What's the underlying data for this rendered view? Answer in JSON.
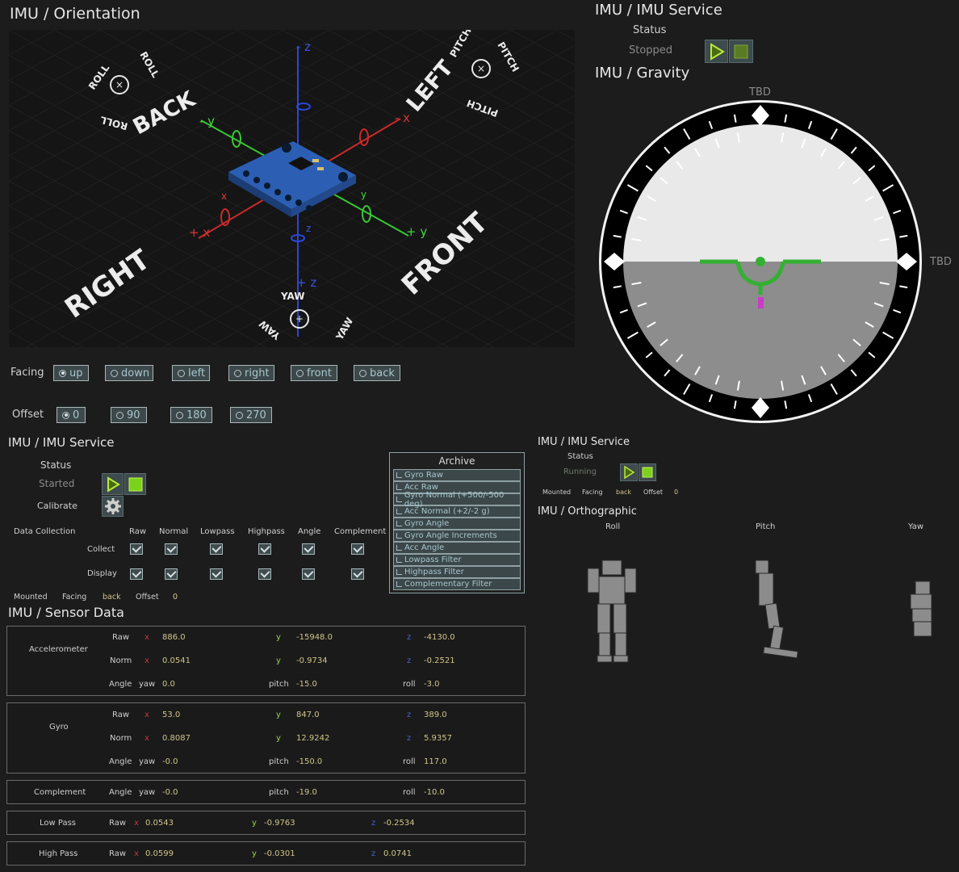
{
  "orientation": {
    "title": "IMU / Orientation",
    "labels": {
      "roll": "ROLL",
      "pitch": "PITCH",
      "yaw": "YAW",
      "back": "BACK",
      "left": "LEFT",
      "right": "RIGHT",
      "front": "FRONT"
    },
    "axes": {
      "neg_z": "- z",
      "pos_z": "+ z",
      "neg_y": "- y",
      "pos_y": "+ y",
      "neg_x": "- x",
      "pos_x": "+ x",
      "x": "x",
      "y": "y",
      "z": "z"
    }
  },
  "facing": {
    "label": "Facing",
    "options": [
      "up",
      "down",
      "left",
      "right",
      "front",
      "back"
    ],
    "selected": "up"
  },
  "offset": {
    "label": "Offset",
    "options": [
      "0",
      "90",
      "180",
      "270"
    ],
    "selected": "0"
  },
  "service_top": {
    "title": "IMU / IMU Service",
    "status_label": "Status",
    "status_value": "Stopped"
  },
  "gravity": {
    "title": "IMU / Gravity",
    "top_label": "TBD",
    "right_label": "TBD"
  },
  "service_main": {
    "title": "IMU / IMU Service",
    "status_label": "Status",
    "status_value": "Started",
    "calibrate_label": "Calibrate",
    "data_collection_label": "Data Collection",
    "columns": [
      "Raw",
      "Normal",
      "Lowpass",
      "Highpass",
      "Angle",
      "Complement"
    ],
    "row_collect": "Collect",
    "row_display": "Display",
    "mounted_label": "Mounted",
    "facing_label": "Facing",
    "facing_value": "back",
    "offset_label": "Offset",
    "offset_value": "0"
  },
  "archive": {
    "title": "Archive",
    "items": [
      "Gyro Raw",
      "Acc Raw",
      "Gyro Normal (+500/-500 deg)",
      "Acc Normal (+2/-2 g)",
      "Gyro Angle",
      "Gyro Angle Increments",
      "Acc Angle",
      "Lowpass Filter",
      "Highpass Filter",
      "Complementary Filter"
    ]
  },
  "service_right": {
    "title": "IMU / IMU Service",
    "status_label": "Status",
    "status_value": "Running",
    "mounted_label": "Mounted",
    "facing_label": "Facing",
    "facing_value": "back",
    "offset_label": "Offset",
    "offset_value": "0"
  },
  "ortho": {
    "title": "IMU / Orthographic",
    "roll": "Roll",
    "pitch": "Pitch",
    "yaw": "Yaw"
  },
  "sensor": {
    "title": "IMU / Sensor Data",
    "accelerometer": {
      "label": "Accelerometer",
      "raw": {
        "label": "Raw",
        "x": "886.0",
        "y": "-15948.0",
        "z": "-4130.0"
      },
      "norm": {
        "label": "Norm",
        "x": "0.0541",
        "y": "-0.9734",
        "z": "-0.2521"
      },
      "angle": {
        "label": "Angle",
        "yaw": "0.0",
        "pitch": "-15.0",
        "roll": "-3.0"
      }
    },
    "gyro": {
      "label": "Gyro",
      "raw": {
        "label": "Raw",
        "x": "53.0",
        "y": "847.0",
        "z": "389.0"
      },
      "norm": {
        "label": "Norm",
        "x": "0.8087",
        "y": "12.9242",
        "z": "5.9357"
      },
      "angle": {
        "label": "Angle",
        "yaw": "-0.0",
        "pitch": "-150.0",
        "roll": "117.0"
      }
    },
    "complement": {
      "label": "Complement",
      "angle_label": "Angle",
      "yaw": "-0.0",
      "pitch": "-19.0",
      "roll": "-10.0"
    },
    "lowpass": {
      "label": "Low Pass",
      "raw_label": "Raw",
      "x": "0.0543",
      "y": "-0.9763",
      "z": "-0.2534"
    },
    "highpass": {
      "label": "High Pass",
      "raw_label": "Raw",
      "x": "0.0599",
      "y": "-0.0301",
      "z": "0.0741"
    },
    "letters": {
      "x": "x",
      "y": "y",
      "z": "z",
      "yaw": "yaw",
      "pitch": "pitch",
      "roll": "roll"
    }
  }
}
